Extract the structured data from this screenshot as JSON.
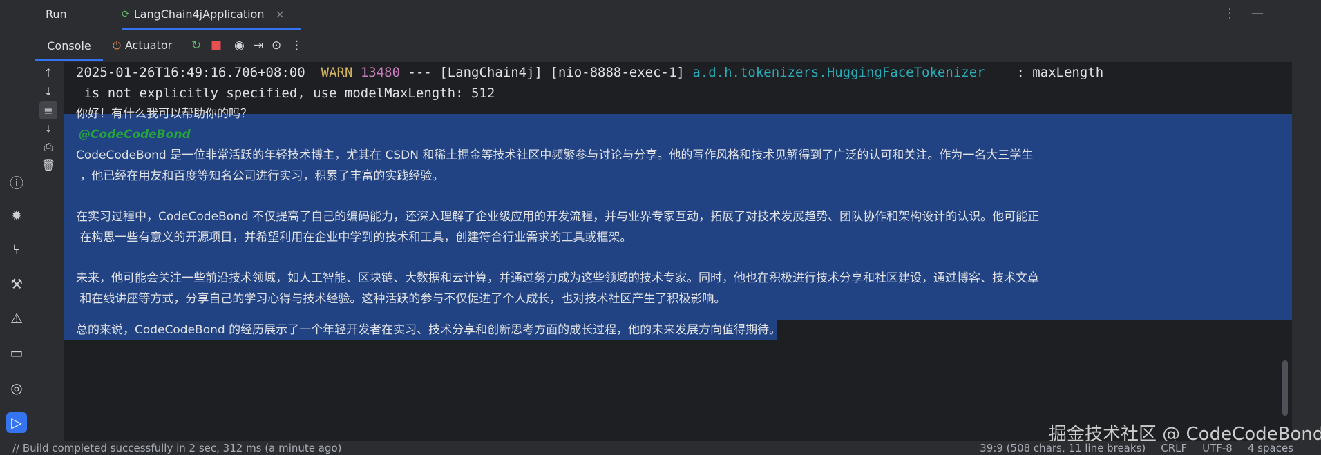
{
  "run_header": {
    "title": "Run",
    "tab_label": "LangChain4jApplication",
    "tab_close": "×",
    "more_icon": "⋮",
    "minimize_icon": "—"
  },
  "console_toolbar": {
    "console_label": "Console",
    "actuator_label": "Actuator"
  },
  "console": {
    "log_line": {
      "timestamp": "2025-01-26T16:49:16.706+08:00",
      "level": "WARN",
      "pid": "13480",
      "separator": "--- [LangChain4j] [nio-8888-exec-1]",
      "logger": "a.d.h.tokenizers.HuggingFaceTokenizer",
      "message": "    : maxLength",
      "continuation": " is not explicitly specified, use modelMaxLength: 512"
    },
    "lines": [
      "你好！有什么我可以帮助你的吗？",
      "@CodeCodeBond",
      "CodeCodeBond 是一位非常活跃的年轻技术博主，尤其在 CSDN 和稀土掘金等技术社区中频繁参与讨论与分享。他的写作风格和技术见解得到了广泛的认可和关注。作为一名大三学生",
      " ，他已经在用友和百度等知名公司进行实习，积累了丰富的实践经验。",
      "",
      "在实习过程中，CodeCodeBond 不仅提高了自己的编码能力，还深入理解了企业级应用的开发流程，并与业界专家互动，拓展了对技术发展趋势、团队协作和架构设计的认识。他可能正",
      " 在构思一些有意义的开源项目，并希望利用在企业中学到的技术和工具，创建符合行业需求的工具或框架。",
      "",
      "未来，他可能会关注一些前沿技术领域，如人工智能、区块链、大数据和云计算，并通过努力成为这些领域的技术专家。同时，他也在积极进行技术分享和社区建设，通过博客、技术文章",
      " 和在线讲座等方式，分享自己的学习心得与技术经验。这种活跃的参与不仅促进了个人成长，也对技术社区产生了积极影响。",
      "",
      "总的来说，CodeCodeBond 的经历展示了一个年轻开发者在实习、技术分享和创新思考方面的成长过程，他的未来发展方向值得期待。"
    ]
  },
  "status_bar": {
    "left": "// Build completed successfully in 2 sec, 312 ms (a minute ago)",
    "position": "39:9 (508 chars, 11 line breaks)",
    "line_sep": "CRLF",
    "encoding": "UTF-8",
    "indent": "4 spaces"
  },
  "watermark": "掘金技术社区 @ CodeCodeBond",
  "colors": {
    "accent": "#3574f0",
    "selection": "#214283",
    "warn": "#d5b461",
    "logger": "#2aacb8"
  },
  "icons": {
    "left_strip": [
      "problems-icon",
      "debug-icon",
      "git-icon",
      "build-icon",
      "warning-icon",
      "terminal-icon",
      "services-icon",
      "run-icon"
    ],
    "gutter": [
      "scroll-up-icon",
      "scroll-down-icon",
      "soft-wrap-icon",
      "scroll-to-end-icon",
      "print-icon",
      "clear-icon"
    ]
  }
}
